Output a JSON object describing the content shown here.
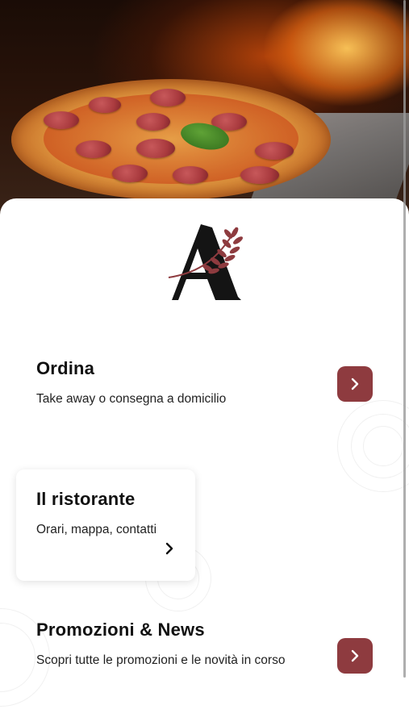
{
  "hero": {
    "image": "pizza-wood-oven-photo"
  },
  "logo": {
    "letter": "A",
    "icon": "wheat-icon"
  },
  "colors": {
    "accent": "#8e3b3f",
    "text": "#111111",
    "background": "#ffffff"
  },
  "sections": [
    {
      "title": "Ordina",
      "subtitle": "Take away o consegna a domicilio",
      "icon": "chevron-right-icon"
    },
    {
      "title": "Il ristorante",
      "subtitle": "Orari, mappa, contatti",
      "icon": "chevron-right-icon"
    },
    {
      "title": "Promozioni & News",
      "subtitle": "Scopri tutte le promozioni e le novità in corso",
      "icon": "chevron-right-icon"
    }
  ]
}
